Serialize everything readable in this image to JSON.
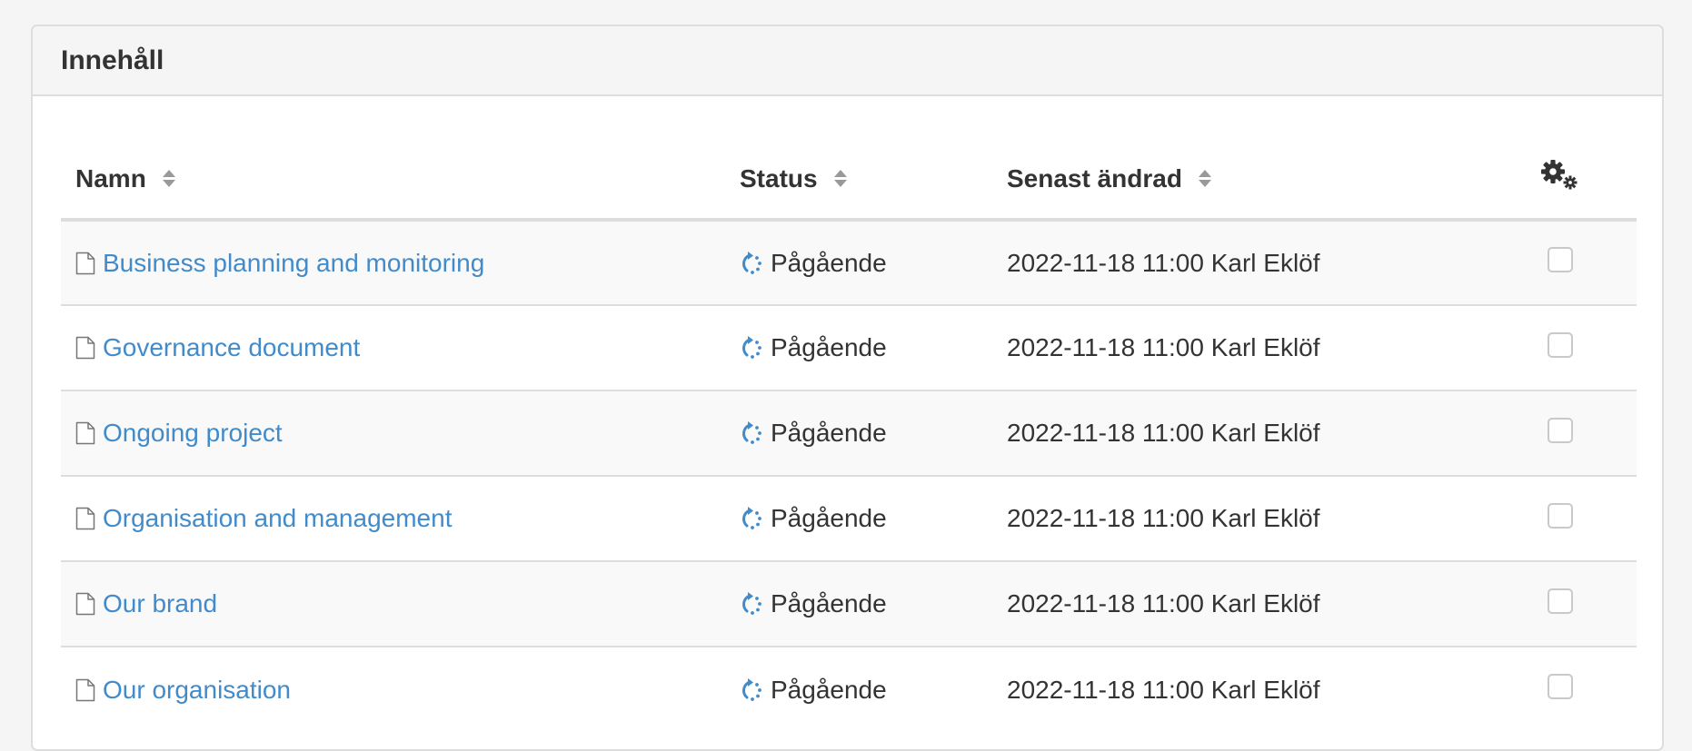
{
  "panel": {
    "title": "Innehåll"
  },
  "table": {
    "columns": {
      "name": "Namn",
      "status": "Status",
      "modified": "Senast ändrad"
    },
    "settings_icon": "gears-icon",
    "rows": [
      {
        "name": "Business planning and monitoring",
        "status": "Pågående",
        "modified": "2022-11-18 11:00 Karl Eklöf",
        "checked": false
      },
      {
        "name": "Governance document",
        "status": "Pågående",
        "modified": "2022-11-18 11:00 Karl Eklöf",
        "checked": false
      },
      {
        "name": "Ongoing project",
        "status": "Pågående",
        "modified": "2022-11-18 11:00 Karl Eklöf",
        "checked": false
      },
      {
        "name": "Organisation and management",
        "status": "Pågående",
        "modified": "2022-11-18 11:00 Karl Eklöf",
        "checked": false
      },
      {
        "name": "Our brand",
        "status": "Pågående",
        "modified": "2022-11-18 11:00 Karl Eklöf",
        "checked": false
      },
      {
        "name": "Our organisation",
        "status": "Pågående",
        "modified": "2022-11-18 11:00 Karl Eklöf",
        "checked": false
      }
    ]
  },
  "colors": {
    "link": "#428bca",
    "status_icon": "#428bca",
    "header_bg": "#f5f5f5",
    "row_stripe": "#f9f9f9",
    "border": "#dddddd"
  }
}
